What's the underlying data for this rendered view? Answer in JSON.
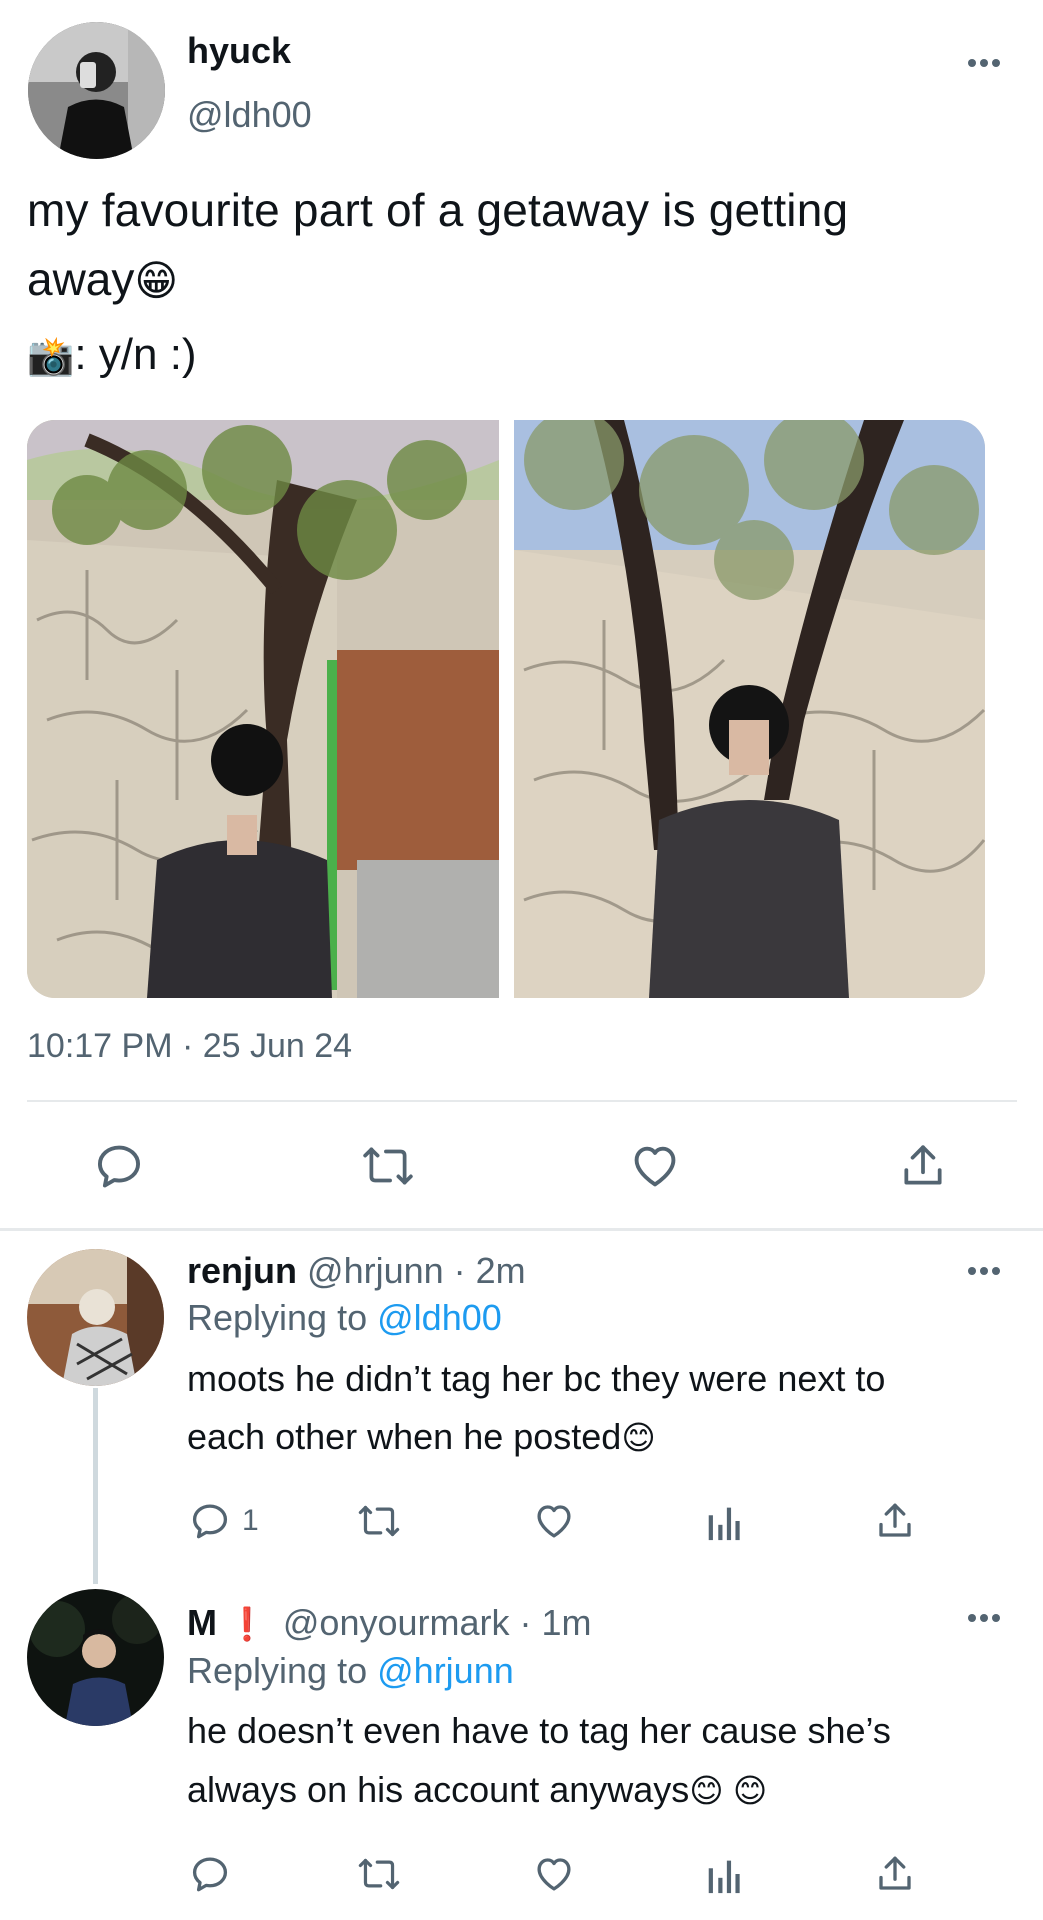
{
  "main_tweet": {
    "display_name": "hyuck",
    "handle": "@ldh00",
    "text_line1": "my favourite part of a getaway is getting",
    "text_line2": "away",
    "emoji_grin": "😁",
    "credit_emoji": "📸",
    "credit_text": ": y/n :)",
    "timestamp": "10:17 PM · 25 Jun 24",
    "actions": [
      "reply-icon",
      "retweet-icon",
      "like-icon",
      "share-icon"
    ]
  },
  "replies": [
    {
      "display_name": "renjun",
      "handle": "@hrjunn",
      "time": "· 2m",
      "replying_label": "Replying to",
      "replying_to": "@ldh00",
      "text_line1": "moots he didn’t tag her bc they were next to",
      "text_line2": "each other when he posted",
      "emoji": "😊",
      "reply_count": "1"
    },
    {
      "display_name": "M",
      "name_badge": "❗",
      "handle": "@onyourmark",
      "time": "· 1m",
      "replying_label": "Replying to",
      "replying_to": "@hrjunn",
      "text_line1": "he doesn’t even have to tag her cause she’s",
      "text_line2": "always on his account anyways",
      "emoji": "😊 😊"
    }
  ],
  "colors": {
    "text": "#0f1419",
    "secondary": "#536471",
    "link": "#1d9bf0",
    "divider": "#e6e9eb"
  }
}
